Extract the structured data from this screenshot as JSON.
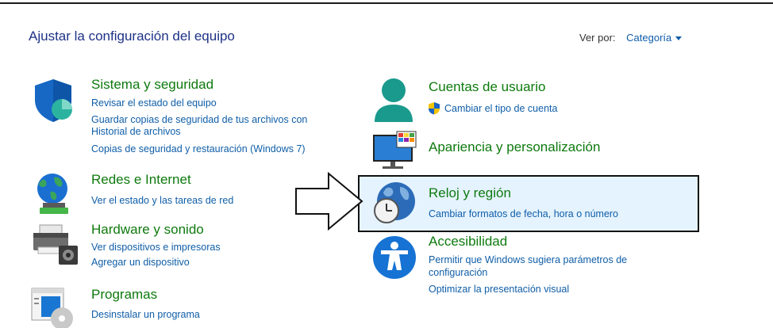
{
  "page": {
    "title": "Ajustar la configuración del equipo",
    "view_by_label": "Ver por:",
    "view_by_value": "Categoría"
  },
  "categories": {
    "system": {
      "title": "Sistema y seguridad",
      "links": [
        "Revisar el estado del equipo",
        "Guardar copias de seguridad de tus archivos con",
        "Historial de archivos",
        "Copias de seguridad y restauración (Windows 7)"
      ]
    },
    "network": {
      "title": "Redes e Internet",
      "links": [
        "Ver el estado y las tareas de red"
      ]
    },
    "hardware": {
      "title": "Hardware y sonido",
      "links": [
        "Ver dispositivos e impresoras",
        "Agregar un dispositivo"
      ]
    },
    "programs": {
      "title": "Programas",
      "links": [
        "Desinstalar un programa"
      ]
    },
    "accounts": {
      "title": "Cuentas de usuario",
      "links": [
        "Cambiar el tipo de cuenta"
      ]
    },
    "appearance": {
      "title": "Apariencia y personalización",
      "links": []
    },
    "clock": {
      "title": "Reloj y región",
      "links": [
        "Cambiar formatos de fecha, hora o número"
      ]
    },
    "accessibility": {
      "title": "Accesibilidad",
      "links": [
        "Permitir que Windows sugiera parámetros de",
        "configuración",
        "Optimizar la presentación visual"
      ]
    }
  },
  "colors": {
    "heading_green": "#0e7a0e",
    "link_blue": "#0f5ea8",
    "highlight_bg": "#e5f3ff"
  }
}
